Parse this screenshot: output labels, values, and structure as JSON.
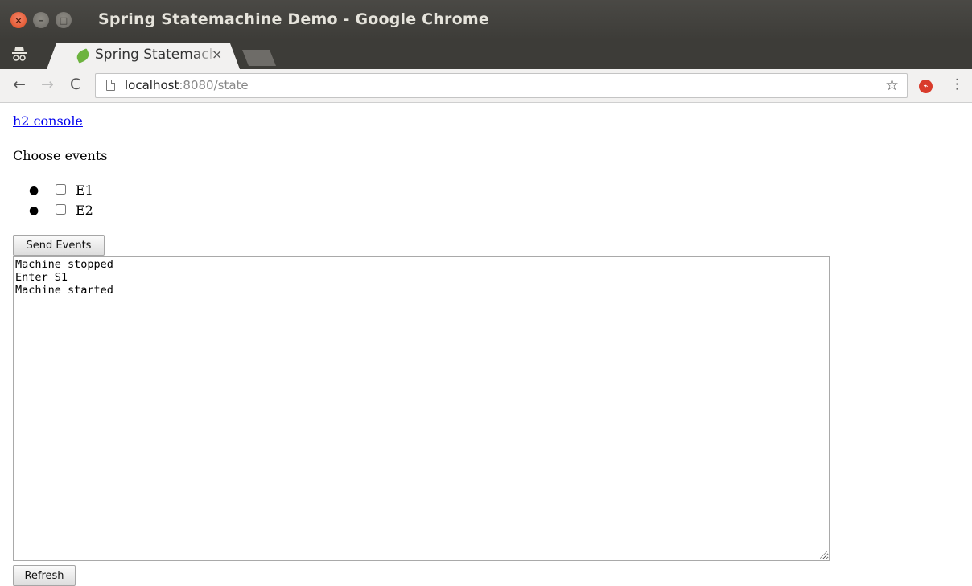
{
  "window": {
    "title": "Spring Statemachine Demo - Google Chrome"
  },
  "tab": {
    "title": "Spring Statemachine Demo",
    "close_glyph": "×"
  },
  "toolbar": {
    "back_glyph": "←",
    "forward_glyph": "→",
    "reload_glyph": "C",
    "url_host": "localhost",
    "url_rest": ":8080/state",
    "star_glyph": "☆",
    "menu_glyph": "⋮"
  },
  "page": {
    "link_text": "h2 console",
    "choose_label": "Choose events",
    "events": [
      {
        "label": "E1",
        "checked": false
      },
      {
        "label": "E2",
        "checked": false
      }
    ],
    "send_button": "Send Events",
    "log_text": "Machine stopped\nEnter S1\nMachine started",
    "refresh_button": "Refresh"
  },
  "icons": {
    "incognito": "incognito-icon",
    "favicon": "spring-leaf-icon",
    "extension": "extension-icon"
  },
  "colors": {
    "link": "#0000ee",
    "close_button": "#df4b1f",
    "favicon": "#6db33f"
  }
}
